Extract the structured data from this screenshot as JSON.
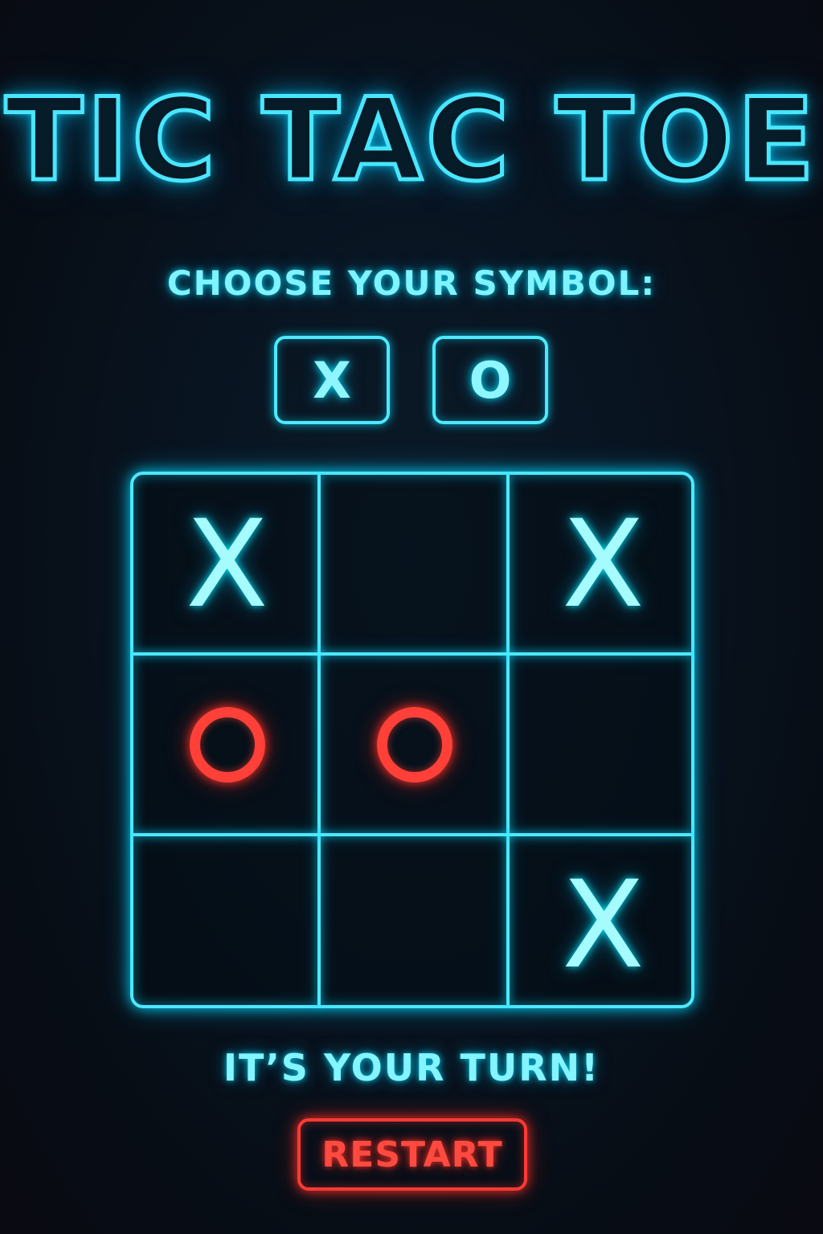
{
  "game": {
    "title": "TIC TAC TOE",
    "choose_prompt": "CHOOSE YOUR SYMBOL:",
    "symbol_options": [
      "X",
      "O"
    ],
    "board": [
      "X",
      "",
      "X",
      "O",
      "O",
      "",
      "",
      "",
      "X"
    ],
    "status": "IT’S YOUR TURN!",
    "restart_label": "RESTART"
  },
  "colors": {
    "background": "#08131f",
    "neon_cyan": "#4ee8ff",
    "x_mark": "#a6fbff",
    "o_mark": "#ff4038",
    "restart": "#ff3a34"
  },
  "icons": {
    "x_mark": "x-mark-icon",
    "o_mark": "o-ring-icon"
  }
}
